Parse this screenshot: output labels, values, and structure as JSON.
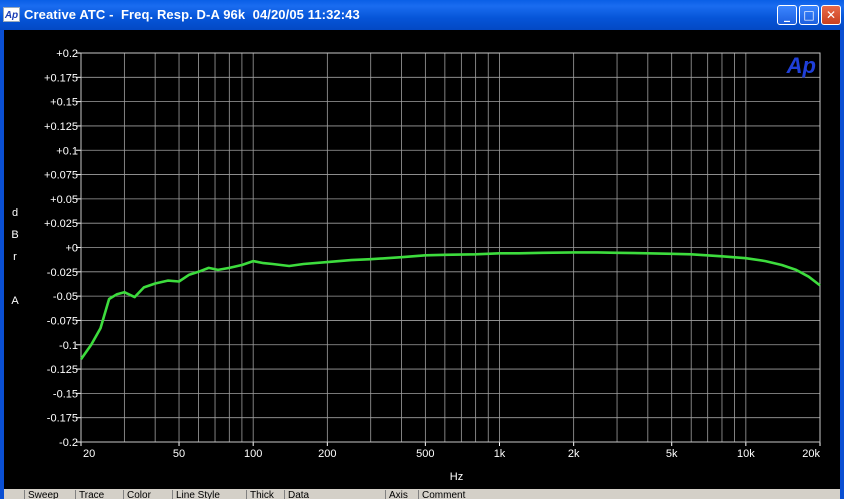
{
  "window": {
    "app_icon_text": "Ap",
    "title": "Creative ATC -  Freq. Resp. D-A 96k  04/20/05 11:32:43",
    "buttons": {
      "minimize": "_",
      "maximize": "□",
      "close": "✕"
    }
  },
  "chart_data": {
    "type": "line",
    "logo": "Ap",
    "title": "",
    "xlabel": "Hz",
    "ylabel": "d B r   A",
    "x_scale": "log",
    "xlim": [
      20,
      20000
    ],
    "ylim": [
      -0.2,
      0.2
    ],
    "grid": true,
    "background": "#000000",
    "grid_color": "#a0a0a0",
    "line_color": "#3ddc3d",
    "x_ticks": [
      {
        "value": 20,
        "label": "20"
      },
      {
        "value": 50,
        "label": "50"
      },
      {
        "value": 100,
        "label": "100"
      },
      {
        "value": 200,
        "label": "200"
      },
      {
        "value": 500,
        "label": "500"
      },
      {
        "value": 1000,
        "label": "1k"
      },
      {
        "value": 2000,
        "label": "2k"
      },
      {
        "value": 5000,
        "label": "5k"
      },
      {
        "value": 10000,
        "label": "10k"
      },
      {
        "value": 20000,
        "label": "20k"
      }
    ],
    "y_ticks": [
      {
        "value": 0.2,
        "label": "+0.2"
      },
      {
        "value": 0.175,
        "label": "+0.175"
      },
      {
        "value": 0.15,
        "label": "+0.15"
      },
      {
        "value": 0.125,
        "label": "+0.125"
      },
      {
        "value": 0.1,
        "label": "+0.1"
      },
      {
        "value": 0.075,
        "label": "+0.075"
      },
      {
        "value": 0.05,
        "label": "+0.05"
      },
      {
        "value": 0.025,
        "label": "+0.025"
      },
      {
        "value": 0,
        "label": "+0"
      },
      {
        "value": -0.025,
        "label": "-0.025"
      },
      {
        "value": -0.05,
        "label": "-0.05"
      },
      {
        "value": -0.075,
        "label": "-0.075"
      },
      {
        "value": -0.1,
        "label": "-0.1"
      },
      {
        "value": -0.125,
        "label": "-0.125"
      },
      {
        "value": -0.15,
        "label": "-0.15"
      },
      {
        "value": -0.175,
        "label": "-0.175"
      },
      {
        "value": -0.2,
        "label": "-0.2"
      }
    ],
    "series": [
      {
        "x": [
          20,
          22,
          24,
          26,
          28,
          30,
          33,
          36,
          40,
          45,
          50,
          55,
          60,
          66,
          72,
          80,
          90,
          100,
          110,
          120,
          140,
          160,
          200,
          250,
          300,
          400,
          500,
          600,
          800,
          1000,
          1200,
          1500,
          2000,
          2500,
          3000,
          4000,
          5000,
          6000,
          8000,
          10000,
          12000,
          14000,
          16000,
          18000,
          20000
        ],
        "y": [
          -0.115,
          -0.1,
          -0.083,
          -0.053,
          -0.048,
          -0.046,
          -0.051,
          -0.041,
          -0.037,
          -0.034,
          -0.035,
          -0.028,
          -0.025,
          -0.021,
          -0.023,
          -0.021,
          -0.018,
          -0.014,
          -0.016,
          -0.017,
          -0.019,
          -0.017,
          -0.015,
          -0.013,
          -0.012,
          -0.01,
          -0.008,
          -0.0075,
          -0.007,
          -0.006,
          -0.006,
          -0.0055,
          -0.005,
          -0.005,
          -0.0055,
          -0.006,
          -0.0065,
          -0.007,
          -0.009,
          -0.011,
          -0.014,
          -0.018,
          -0.023,
          -0.03,
          -0.039
        ]
      }
    ]
  },
  "status_columns": [
    "Sweep",
    "Trace",
    "Color",
    "Line Style",
    "Thick",
    "Data",
    "Axis",
    "Comment"
  ]
}
